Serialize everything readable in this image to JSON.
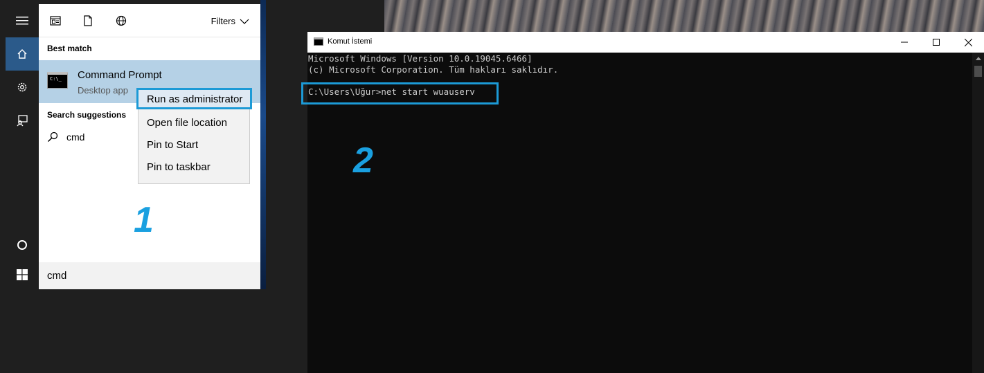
{
  "start_menu": {
    "rail": {
      "menu_icon": "hamburger-icon",
      "home_icon": "home-icon",
      "settings_icon": "gear-icon",
      "feedback_icon": "feedback-icon",
      "cortana_icon": "cortana-circle-icon",
      "start_icon": "windows-logo-icon"
    },
    "toolbar": {
      "apps_icon": "apps-icon",
      "documents_icon": "document-icon",
      "web_icon": "globe-icon",
      "filters_label": "Filters"
    },
    "best_match_label": "Best match",
    "best_match_item": {
      "title": "Command Prompt",
      "subtitle": "Desktop app"
    },
    "search_suggestions_label": "Search suggestions",
    "suggestion": "cmd",
    "search_query": "cmd",
    "step_number": "1",
    "context_menu": {
      "items": [
        "Run as administrator",
        "Open file location",
        "Pin to Start",
        "Pin to taskbar"
      ]
    }
  },
  "cmd_window": {
    "title": "Komut İstemi",
    "controls": [
      "minimize-icon",
      "maximize-icon",
      "close-icon"
    ],
    "lines": [
      "Microsoft Windows [Version 10.0.19045.6466]",
      "(c) Microsoft Corporation. Tüm hakları saklıdır.",
      "",
      "C:\\Users\\Uğur>net start wuauserv"
    ],
    "step_number": "2"
  },
  "colors": {
    "accent_highlight": "#1c9ad6",
    "step_number": "#1aa0e0",
    "selected_item": "#b5d1e6",
    "console_bg": "#0c0c0c",
    "console_text": "#cccccc"
  }
}
